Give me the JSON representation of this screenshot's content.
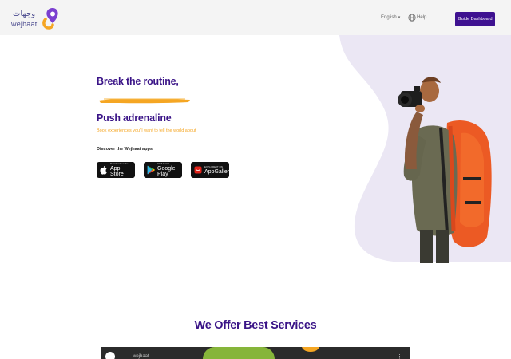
{
  "header": {
    "logo_ar": "وجهات",
    "logo_en": "wejhaat",
    "language": "English",
    "help": "Help",
    "guide_dashboard": "Guide Dashboard"
  },
  "hero": {
    "headline1": "Break the routine,",
    "headline2": "Push adrenaline",
    "subline": "Book experiences you'll want to tell the world about",
    "discover": "Discover the Wejhaat apps",
    "stores": {
      "appstore_small": "Download on the",
      "appstore_big": "App Store",
      "gplay_small": "GET IT ON",
      "gplay_big": "Google Play",
      "huawei_small": "EXPLORE IT ON",
      "huawei_big": "AppGallery"
    }
  },
  "services": {
    "title": "We Offer Best Services",
    "video_title": "wejhaat"
  },
  "colors": {
    "brand_purple": "#3a1487",
    "accent_orange": "#f5a623",
    "button_purple": "#3e1190"
  }
}
